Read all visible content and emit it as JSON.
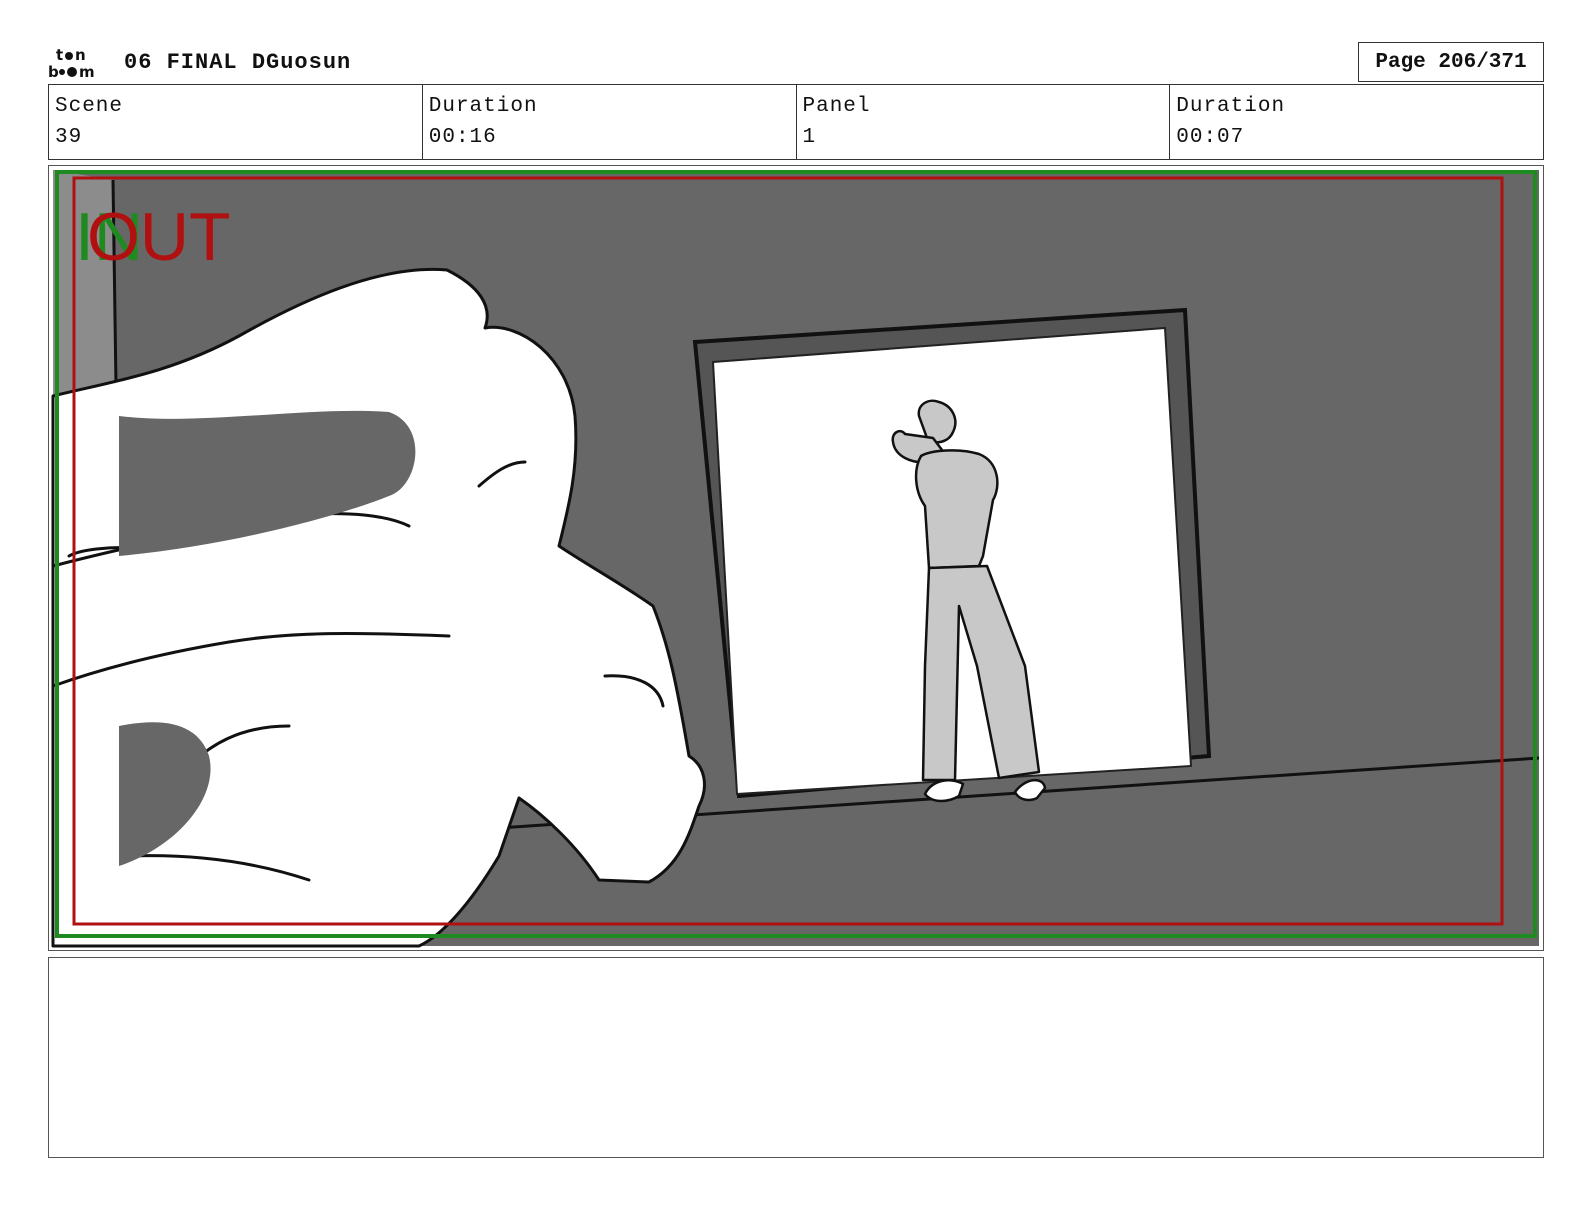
{
  "header": {
    "logo_text": "toon boom",
    "title": "06 FINAL DGuosun",
    "page": "Page 206/371"
  },
  "info": {
    "scene_label": "Scene",
    "scene_value": "39",
    "scene_duration_label": "Duration",
    "scene_duration_value": "00:16",
    "panel_label": "Panel",
    "panel_value": "1",
    "panel_duration_label": "Duration",
    "panel_duration_value": "00:07"
  },
  "panel": {
    "in_label": "IN",
    "out_label": "OUT",
    "colors": {
      "in": "#1f8a1f",
      "out": "#b01010",
      "wall": "#676767",
      "doorway": "#ffffff"
    }
  },
  "notes": {
    "text": ""
  }
}
